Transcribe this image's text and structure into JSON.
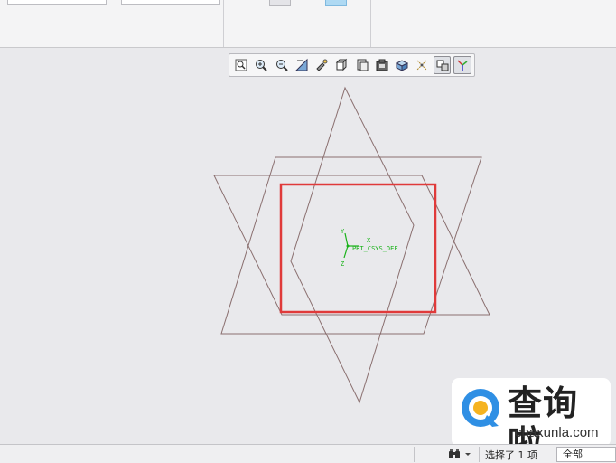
{
  "ribbon": {},
  "graphics_toolbar": {
    "buttons": [
      {
        "name": "refit",
        "icon": "zoom-fit-icon"
      },
      {
        "name": "zoom-in",
        "icon": "zoom-in-icon"
      },
      {
        "name": "zoom-out",
        "icon": "zoom-out-icon"
      },
      {
        "name": "repaint",
        "icon": "repaint-icon"
      },
      {
        "name": "reorient",
        "icon": "reorient-icon"
      },
      {
        "name": "display-style",
        "icon": "display-style-icon"
      },
      {
        "name": "saved-views",
        "icon": "saved-views-icon"
      },
      {
        "name": "view-manager",
        "icon": "view-manager-icon"
      },
      {
        "name": "section",
        "icon": "section-icon"
      },
      {
        "name": "datum-display",
        "icon": "datum-display-icon"
      },
      {
        "name": "spin-center",
        "icon": "spin-center-icon"
      },
      {
        "name": "annotation-display",
        "icon": "annotation-display-icon"
      }
    ]
  },
  "canvas": {
    "csys_name": "PRT_CSYS_DEF",
    "axis_x": "X",
    "axis_y": "Y",
    "axis_z": "Z",
    "colors": {
      "datum_edges": "#8a6f6f",
      "highlight": "#e03a3a",
      "csys": "#19b219",
      "background": "#e9e9ec"
    }
  },
  "watermark": {
    "title": "查询啦",
    "subtitle": "chaxunla.com"
  },
  "statusbar": {
    "selection_text": "选择了 1 项",
    "filter_value": "全部"
  }
}
